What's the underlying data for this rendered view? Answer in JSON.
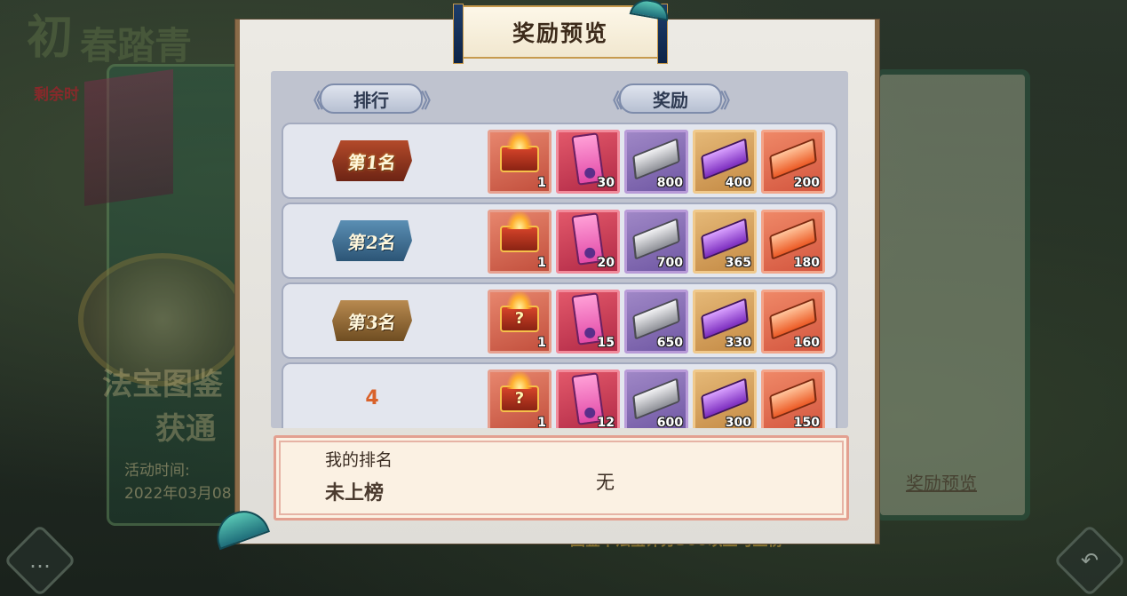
{
  "background": {
    "title_chars": [
      "初",
      "春踏青"
    ],
    "remaining_time_label": "剩余时",
    "event_name_line1": "法宝图鉴",
    "event_name_line2": "获通",
    "activity_time_label": "活动时间:",
    "activity_time_value": "2022年03月08",
    "reward_preview_link": "奖励预览",
    "footer_note": "图鉴中法宝评分300以上可上榜"
  },
  "modal": {
    "title": "奖励预览",
    "headers": {
      "rank": "排行",
      "reward": "奖励"
    },
    "rows": [
      {
        "rank_label": "第1名",
        "badge": "gold",
        "items": [
          {
            "type": "chest",
            "count": "1"
          },
          {
            "type": "scroll",
            "count": "30"
          },
          {
            "type": "silver",
            "count": "800"
          },
          {
            "type": "violet",
            "count": "400"
          },
          {
            "type": "orange",
            "count": "200"
          }
        ]
      },
      {
        "rank_label": "第2名",
        "badge": "blue",
        "items": [
          {
            "type": "chest",
            "count": "1"
          },
          {
            "type": "scroll",
            "count": "20"
          },
          {
            "type": "silver",
            "count": "700"
          },
          {
            "type": "violet",
            "count": "365"
          },
          {
            "type": "orange",
            "count": "180"
          }
        ]
      },
      {
        "rank_label": "第3名",
        "badge": "bronze",
        "items": [
          {
            "type": "chest-mystery",
            "count": "1"
          },
          {
            "type": "scroll",
            "count": "15"
          },
          {
            "type": "silver",
            "count": "650"
          },
          {
            "type": "violet",
            "count": "330"
          },
          {
            "type": "orange",
            "count": "160"
          }
        ]
      },
      {
        "rank_label": "4",
        "badge": "plain",
        "items": [
          {
            "type": "chest-mystery",
            "count": "1"
          },
          {
            "type": "scroll",
            "count": "12"
          },
          {
            "type": "silver",
            "count": "600"
          },
          {
            "type": "violet",
            "count": "300"
          },
          {
            "type": "orange",
            "count": "150"
          }
        ]
      }
    ],
    "my_rank": {
      "label": "我的排名",
      "value": "未上榜",
      "reward": "无"
    }
  },
  "colors": {
    "modal_bg": "#eceae4",
    "table_bg": "#bfc3cf",
    "rank4_text": "#d9622b",
    "my_rank_bg": "#fbf1e3"
  },
  "icons": {
    "chest": "treasure-chest-icon",
    "chest-mystery": "mystery-chest-icon",
    "scroll": "talisman-scroll-icon",
    "silver": "silver-ingot-icon",
    "violet": "purple-ingot-icon",
    "orange": "orange-ingot-icon"
  }
}
